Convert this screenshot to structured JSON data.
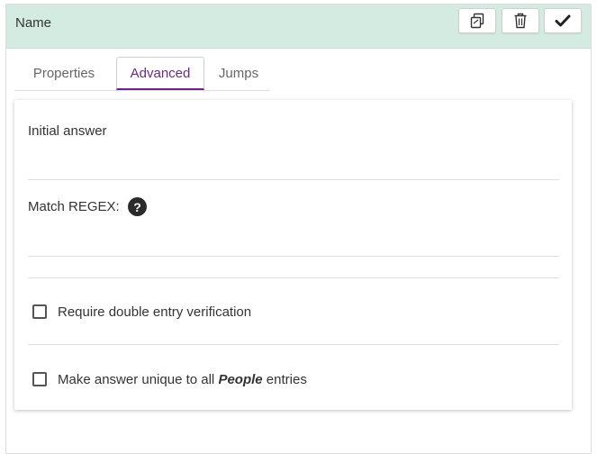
{
  "header": {
    "title": "Name",
    "background": "#d3ebe1"
  },
  "toolbar": {
    "copy_icon": "copy-icon",
    "delete_icon": "trash-icon",
    "confirm_icon": "check-icon"
  },
  "tabs": [
    {
      "label": "Properties",
      "active": false
    },
    {
      "label": "Advanced",
      "active": true
    },
    {
      "label": "Jumps",
      "active": false
    }
  ],
  "fields": {
    "initial_answer": {
      "label": "Initial answer",
      "value": ""
    },
    "match_regex": {
      "label": "Match REGEX",
      "colon": ":",
      "value": "",
      "help_icon": "question-circle-icon",
      "help_glyph": "?"
    }
  },
  "options": {
    "double_entry": {
      "label": "Require double entry verification",
      "checked": false
    },
    "unique": {
      "label_before": "Make answer unique to all",
      "label_emph": "People",
      "label_after": "entries",
      "checked": false
    }
  },
  "accent": "#6a2a82"
}
